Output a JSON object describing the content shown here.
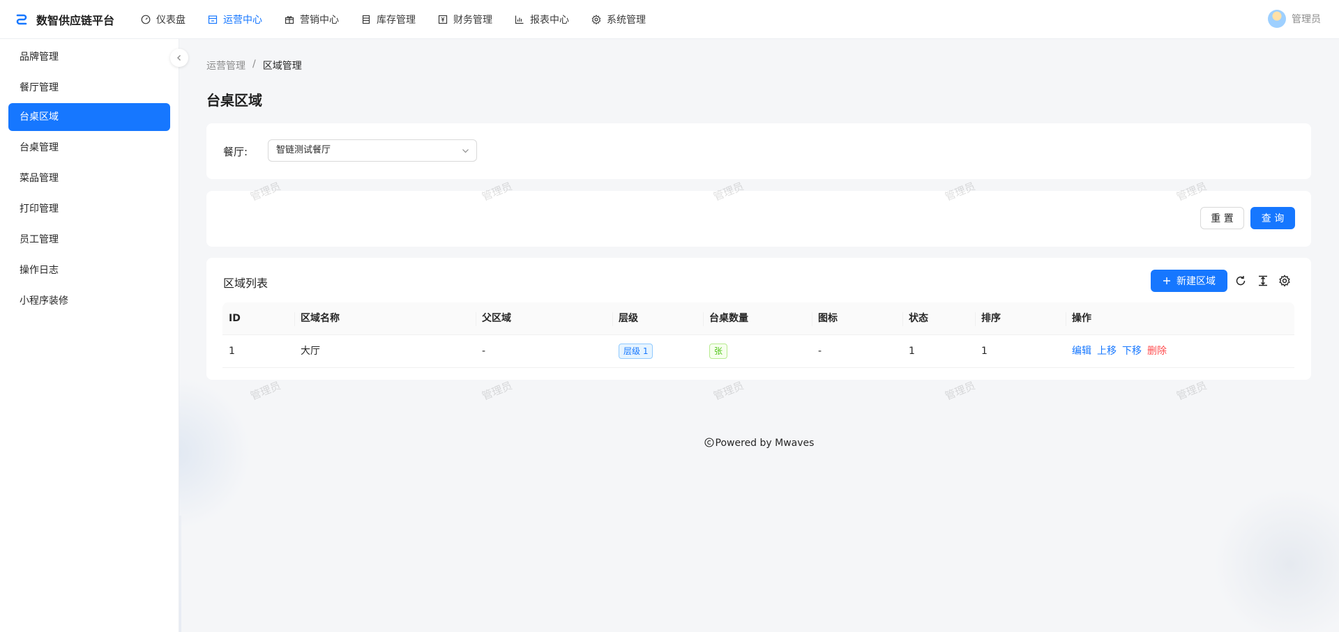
{
  "app": {
    "title": "数智供应链平台",
    "brand_color": "#1677ff"
  },
  "topnav": [
    {
      "label": "仪表盘",
      "icon": "dashboard-icon",
      "active": false
    },
    {
      "label": "运营中心",
      "icon": "store-icon",
      "active": true
    },
    {
      "label": "营销中心",
      "icon": "gift-icon",
      "active": false
    },
    {
      "label": "库存管理",
      "icon": "inventory-icon",
      "active": false
    },
    {
      "label": "财务管理",
      "icon": "finance-icon",
      "active": false
    },
    {
      "label": "报表中心",
      "icon": "bar-chart-icon",
      "active": false
    },
    {
      "label": "系统管理",
      "icon": "gear-icon",
      "active": false
    }
  ],
  "user": {
    "name": "管理员"
  },
  "sidebar": {
    "items": [
      {
        "label": "品牌管理"
      },
      {
        "label": "餐厅管理"
      },
      {
        "label": "台桌区域",
        "active": true
      },
      {
        "label": "台桌管理"
      },
      {
        "label": "菜品管理"
      },
      {
        "label": "打印管理"
      },
      {
        "label": "员工管理"
      },
      {
        "label": "操作日志"
      },
      {
        "label": "小程序装修"
      }
    ]
  },
  "breadcrumb": {
    "parent": "运营管理",
    "separator": "/",
    "current": "区域管理"
  },
  "page_title": "台桌区域",
  "filter": {
    "label": "餐厅:",
    "restaurant_value": "智链测试餐厅"
  },
  "actions": {
    "reset": "重 置",
    "query": "查 询"
  },
  "table": {
    "title": "区域列表",
    "add_button": "新建区域",
    "columns": [
      "ID",
      "区域名称",
      "父区域",
      "层级",
      "台桌数量",
      "图标",
      "状态",
      "排序",
      "操作"
    ],
    "rows": [
      {
        "id": "1",
        "name": "大厅",
        "parent": "-",
        "level": "层级 1",
        "table_count": "张",
        "icon": "-",
        "status": "1",
        "sort": "1",
        "ops": {
          "edit": "编辑",
          "up": "上移",
          "down": "下移",
          "delete": "删除"
        }
      }
    ]
  },
  "watermark": "管理员",
  "footer": {
    "text": "Powered by Mwaves"
  }
}
